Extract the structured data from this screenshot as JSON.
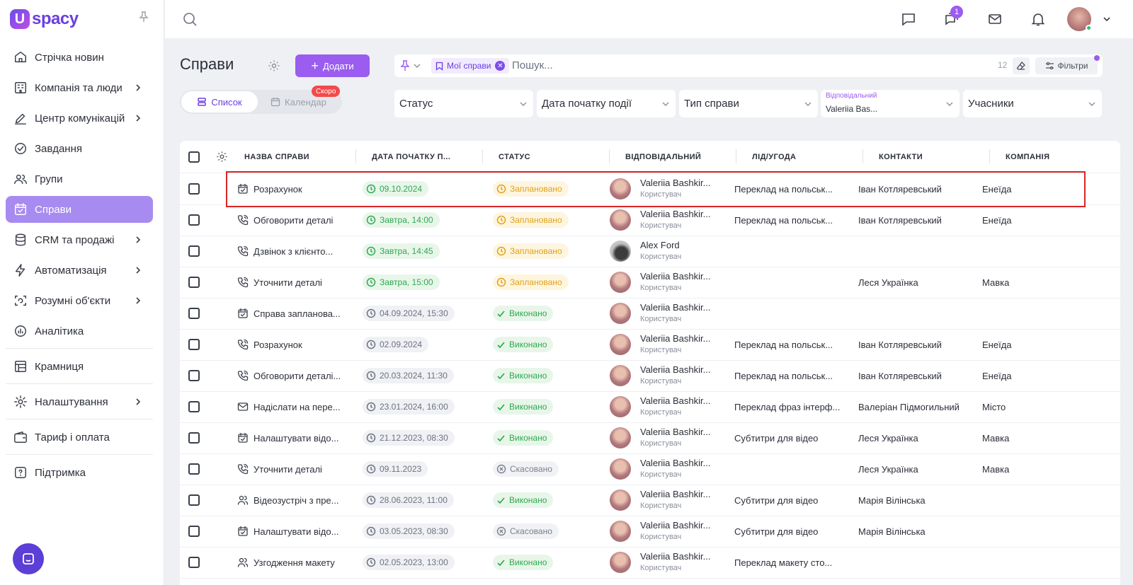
{
  "app": {
    "logo_mark": "U",
    "logo_text": "spacy"
  },
  "sidebar": {
    "items": [
      {
        "label": "Стрічка новин",
        "icon": "home-icon",
        "chevron": false
      },
      {
        "label": "Компанія та люди",
        "icon": "company-icon",
        "chevron": true
      },
      {
        "label": "Центр комунікацій",
        "icon": "edit-icon",
        "chevron": true
      },
      {
        "label": "Завдання",
        "icon": "check-circle-icon",
        "chevron": false
      },
      {
        "label": "Групи",
        "icon": "users-icon",
        "chevron": false
      },
      {
        "label": "Справи",
        "icon": "calendar-check-icon",
        "chevron": false,
        "active": true
      },
      {
        "label": "CRM та продажі",
        "icon": "database-icon",
        "chevron": true
      },
      {
        "label": "Автоматизація",
        "icon": "lightning-icon",
        "chevron": true
      },
      {
        "label": "Розумні об'єкти",
        "icon": "scan-icon",
        "chevron": true
      },
      {
        "label": "Аналітика",
        "icon": "analytics-icon",
        "chevron": false
      },
      {
        "label": "Крамниця",
        "icon": "store-icon",
        "chevron": false
      },
      {
        "label": "Налаштування",
        "icon": "gear-icon",
        "chevron": true
      },
      {
        "label": "Тариф і оплата",
        "icon": "wallet-icon",
        "chevron": false
      },
      {
        "label": "Підтримка",
        "icon": "help-icon",
        "chevron": false
      }
    ]
  },
  "topbar": {
    "chat_badge": "1"
  },
  "page": {
    "title": "Справи",
    "add_label": "Додати",
    "view_list": "Список",
    "view_calendar": "Календар",
    "soon_badge": "Скоро"
  },
  "search": {
    "chip_label": "Мої справи",
    "placeholder": "Пошук...",
    "count": "12",
    "filters_label": "Фільтри"
  },
  "filters": {
    "status": "Статус",
    "start_date": "Дата початку події",
    "type": "Тип справи",
    "responsible_label": "Відповідальний",
    "responsible_value": "Valeriia Bas...",
    "participants": "Учасники"
  },
  "table": {
    "headers": [
      "НАЗВА СПРАВИ",
      "ДАТА ПОЧАТКУ П...",
      "СТАТУС",
      "ВІДПОВІДАЛЬНИЙ",
      "ЛІД/УГОДА",
      "КОНТАКТИ",
      "КОМПАНІЯ"
    ],
    "rows": [
      {
        "name": "Розрахунок",
        "type_icon": "calendar-check-icon",
        "date": "09.10.2024",
        "date_style": "green",
        "status": "Заплановано",
        "status_style": "yellow",
        "resp_name": "Valeriia Bashkir...",
        "resp_role": "Користувач",
        "avatar": "person",
        "lead": "Переклад на польськ...",
        "contact": "Іван Котляревський",
        "company": "Енеїда"
      },
      {
        "name": "Обговорити деталі",
        "type_icon": "phone-icon",
        "date": "Завтра, 14:00",
        "date_style": "green",
        "status": "Заплановано",
        "status_style": "yellow",
        "resp_name": "Valeriia Bashkir...",
        "resp_role": "Користувач",
        "avatar": "person",
        "lead": "Переклад на польськ...",
        "contact": "Іван Котляревський",
        "company": "Енеїда"
      },
      {
        "name": "Дзвінок з клієнто...",
        "type_icon": "phone-icon",
        "date": "Завтра, 14:45",
        "date_style": "green",
        "status": "Заплановано",
        "status_style": "yellow",
        "resp_name": "Alex Ford",
        "resp_role": "Користувач",
        "avatar": "cat",
        "lead": "",
        "contact": "",
        "company": ""
      },
      {
        "name": "Уточнити деталі",
        "type_icon": "phone-icon",
        "date": "Завтра, 15:00",
        "date_style": "green",
        "status": "Заплановано",
        "status_style": "yellow",
        "resp_name": "Valeriia Bashkir...",
        "resp_role": "Користувач",
        "avatar": "person",
        "lead": "",
        "contact": "Леся Українка",
        "company": "Мавка"
      },
      {
        "name": "Справа запланова...",
        "type_icon": "calendar-check-icon",
        "date": "04.09.2024, 15:30",
        "date_style": "grey",
        "status": "Виконано",
        "status_style": "green",
        "resp_name": "Valeriia Bashkir...",
        "resp_role": "Користувач",
        "avatar": "person",
        "lead": "",
        "contact": "",
        "company": ""
      },
      {
        "name": "Розрахунок",
        "type_icon": "phone-icon",
        "date": "02.09.2024",
        "date_style": "grey",
        "status": "Виконано",
        "status_style": "green",
        "resp_name": "Valeriia Bashkir...",
        "resp_role": "Користувач",
        "avatar": "person",
        "lead": "Переклад на польськ...",
        "contact": "Іван Котляревський",
        "company": "Енеїда"
      },
      {
        "name": "Обговорити деталі...",
        "type_icon": "phone-icon",
        "date": "20.03.2024, 11:30",
        "date_style": "grey",
        "status": "Виконано",
        "status_style": "green",
        "resp_name": "Valeriia Bashkir...",
        "resp_role": "Користувач",
        "avatar": "person",
        "lead": "Переклад на польськ...",
        "contact": "Іван Котляревський",
        "company": "Енеїда"
      },
      {
        "name": "Надіслати на пере...",
        "type_icon": "mail-icon",
        "date": "23.01.2024, 16:00",
        "date_style": "grey",
        "status": "Виконано",
        "status_style": "green",
        "resp_name": "Valeriia Bashkir...",
        "resp_role": "Користувач",
        "avatar": "person",
        "lead": "Переклад фраз інтерф...",
        "contact": "Валеріан Підмогильний",
        "company": "Місто"
      },
      {
        "name": "Налаштувати відо...",
        "type_icon": "calendar-check-icon",
        "date": "21.12.2023, 08:30",
        "date_style": "grey",
        "status": "Виконано",
        "status_style": "green",
        "resp_name": "Valeriia Bashkir...",
        "resp_role": "Користувач",
        "avatar": "person",
        "lead": "Субтитри для відео",
        "contact": "Леся Українка",
        "company": "Мавка"
      },
      {
        "name": "Уточнити деталі",
        "type_icon": "phone-icon",
        "date": "09.11.2023",
        "date_style": "grey",
        "status": "Скасовано",
        "status_style": "red",
        "resp_name": "Valeriia Bashkir...",
        "resp_role": "Користувач",
        "avatar": "person",
        "lead": "",
        "contact": "Леся Українка",
        "company": "Мавка"
      },
      {
        "name": "Відеозустріч з пре...",
        "type_icon": "users-icon",
        "date": "28.06.2023, 11:00",
        "date_style": "grey",
        "status": "Виконано",
        "status_style": "green",
        "resp_name": "Valeriia Bashkir...",
        "resp_role": "Користувач",
        "avatar": "person",
        "lead": "Субтитри для відео",
        "contact": "Марія Вілінська",
        "company": ""
      },
      {
        "name": "Налаштувати відо...",
        "type_icon": "calendar-check-icon",
        "date": "03.05.2023, 08:30",
        "date_style": "grey",
        "status": "Скасовано",
        "status_style": "red",
        "resp_name": "Valeriia Bashkir...",
        "resp_role": "Користувач",
        "avatar": "person",
        "lead": "Субтитри для відео",
        "contact": "Марія Вілінська",
        "company": ""
      },
      {
        "name": "Узгодження макету",
        "type_icon": "users-icon",
        "date": "02.05.2023, 13:00",
        "date_style": "grey",
        "status": "Виконано",
        "status_style": "green",
        "resp_name": "Valeriia Bashkir...",
        "resp_role": "Користувач",
        "avatar": "person",
        "lead": "Переклад макету сто...",
        "contact": "",
        "company": ""
      }
    ]
  },
  "colors": {
    "accent": "#9b5cf0",
    "active_nav": "#a88bf0",
    "highlight": "#d92525"
  }
}
